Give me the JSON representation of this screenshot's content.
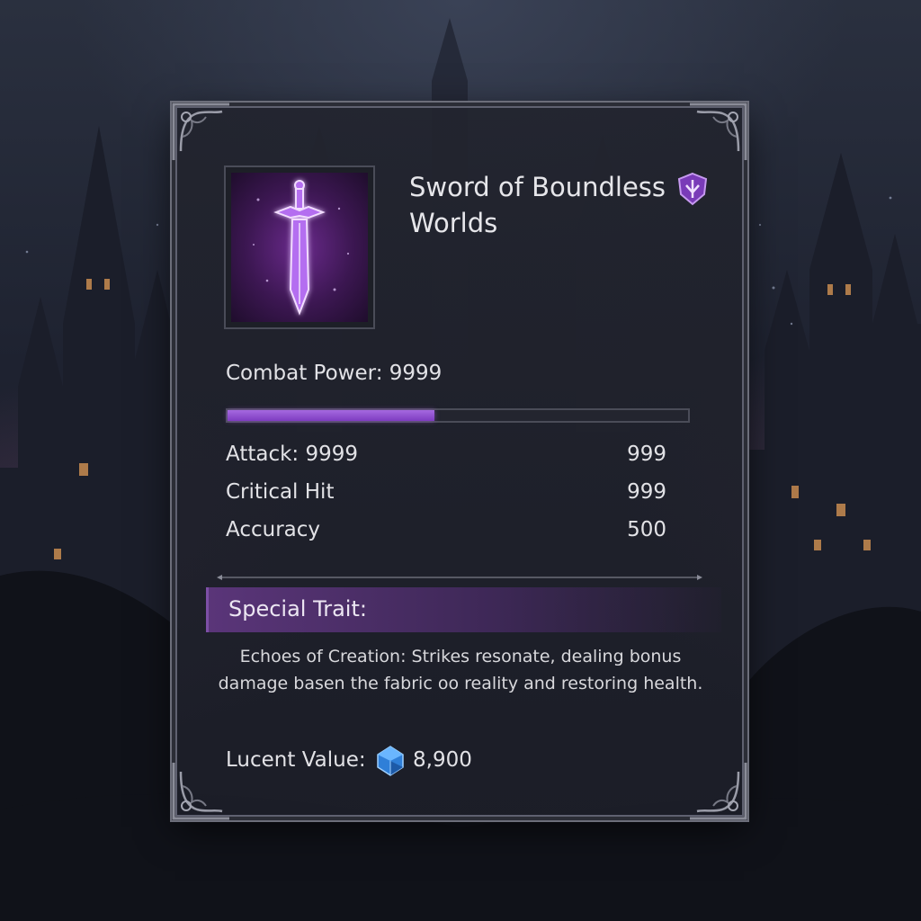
{
  "item": {
    "name": "Sword of Boundless Worlds",
    "icon": "glowing-sword",
    "rarity_icon": "purple-shield-emblem"
  },
  "combat_power": {
    "label": "Combat Power: 9999",
    "bar_fill_percent": 45
  },
  "stats": [
    {
      "label": "Attack: 9999",
      "value": "999"
    },
    {
      "label": "Critical Hit",
      "value": "999"
    },
    {
      "label": "Accuracy",
      "value": "500"
    }
  ],
  "special_trait": {
    "header": "Special Trait:",
    "description": "Echoes of Creation: Strikes resonate, dealing bonus damage basen the fabric oo reality and restoring health."
  },
  "value": {
    "label": "Lucent Value:",
    "icon": "blue-gem",
    "amount": "8,900"
  },
  "colors": {
    "accent_purple": "#8a48c9",
    "panel_bg": "#1f212b",
    "frame_border": "#6c6e7a",
    "gem_blue": "#3a8ee8"
  }
}
